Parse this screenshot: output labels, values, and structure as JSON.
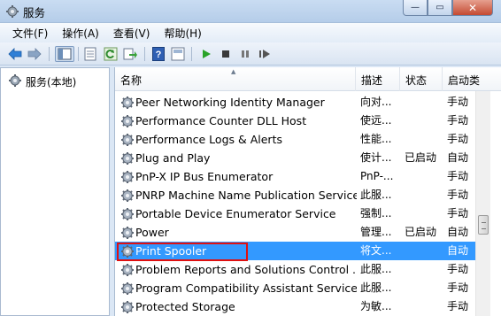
{
  "window": {
    "title": "服务",
    "minimize_label": "—",
    "maximize_label": "▭",
    "close_label": "✕"
  },
  "menu": [
    {
      "label": "文件(F)"
    },
    {
      "label": "操作(A)"
    },
    {
      "label": "查看(V)"
    },
    {
      "label": "帮助(H)"
    }
  ],
  "toolbar": {
    "icons": [
      "back-icon",
      "forward-icon",
      "show-tree-icon",
      "properties-icon",
      "refresh-icon",
      "export-icon",
      "help-icon",
      "view-icon",
      "start-icon",
      "stop-icon",
      "pause-icon",
      "restart-icon"
    ]
  },
  "tree": {
    "root_label": "服务(本地)"
  },
  "columns": {
    "name": "名称",
    "description": "描述",
    "status": "状态",
    "startup": "启动类"
  },
  "services": [
    {
      "name": "Peer Networking Identity Manager",
      "description": "向对...",
      "status": "",
      "startup": "手动"
    },
    {
      "name": "Performance Counter DLL Host",
      "description": "使远...",
      "status": "",
      "startup": "手动"
    },
    {
      "name": "Performance Logs & Alerts",
      "description": "性能...",
      "status": "",
      "startup": "手动"
    },
    {
      "name": "Plug and Play",
      "description": "使计...",
      "status": "已启动",
      "startup": "自动"
    },
    {
      "name": "PnP-X IP Bus Enumerator",
      "description": "PnP-...",
      "status": "",
      "startup": "手动"
    },
    {
      "name": "PNRP Machine Name Publication Service",
      "description": "此服...",
      "status": "",
      "startup": "手动"
    },
    {
      "name": "Portable Device Enumerator Service",
      "description": "强制...",
      "status": "",
      "startup": "手动"
    },
    {
      "name": "Power",
      "description": "管理...",
      "status": "已启动",
      "startup": "自动"
    },
    {
      "name": "Print Spooler",
      "description": "将文...",
      "status": "",
      "startup": "自动"
    },
    {
      "name": "Problem Reports and Solutions Control ...",
      "description": "此服...",
      "status": "",
      "startup": "手动"
    },
    {
      "name": "Program Compatibility Assistant Service",
      "description": "此服...",
      "status": "",
      "startup": "手动"
    },
    {
      "name": "Protected Storage",
      "description": "为敏...",
      "status": "",
      "startup": "手动"
    }
  ],
  "selected_service": "Print Spooler",
  "colors": {
    "selection": "#3399ff",
    "highlight_border": "#e01010"
  }
}
